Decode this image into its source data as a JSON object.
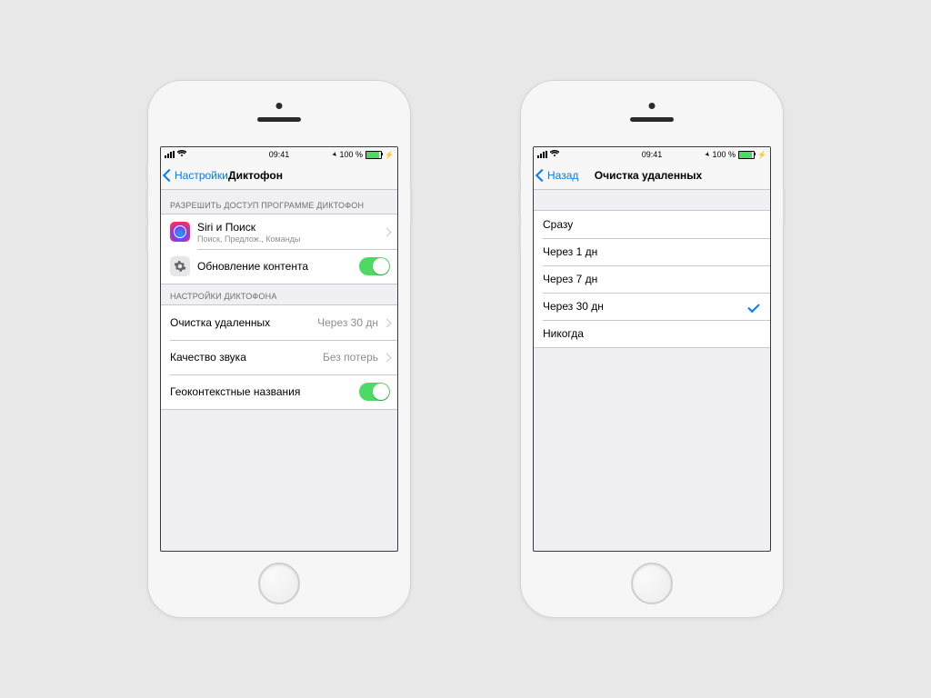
{
  "status": {
    "time": "09:41",
    "battery": "100 %"
  },
  "phoneA": {
    "back": "Настройки",
    "title": "Диктофон",
    "groupAccess": "РАЗРЕШИТЬ ДОСТУП ПРОГРАММЕ ДИКТОФОН",
    "siri": {
      "title": "Siri и Поиск",
      "subtitle": "Поиск, Предлож., Команды"
    },
    "refreshTitle": "Обновление контента",
    "groupSettings": "НАСТРОЙКИ ДИКТОФОНА",
    "clear": {
      "title": "Очистка удаленных",
      "value": "Через 30 дн"
    },
    "quality": {
      "title": "Качество звука",
      "value": "Без потерь"
    },
    "geoTitle": "Геоконтекстные названия"
  },
  "phoneB": {
    "back": "Назад",
    "title": "Очистка удаленных",
    "options": [
      "Сразу",
      "Через 1 дн",
      "Через 7 дн",
      "Через 30 дн",
      "Никогда"
    ],
    "selectedIndex": 3
  }
}
